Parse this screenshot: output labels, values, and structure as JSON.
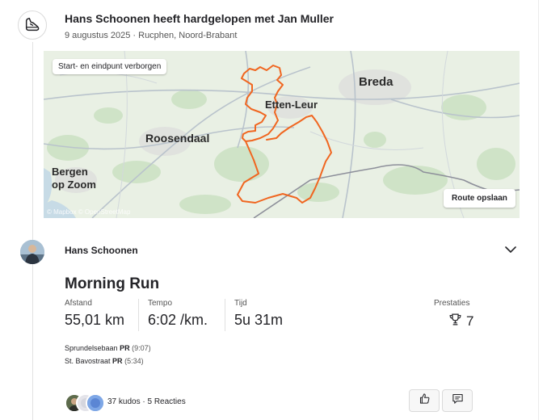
{
  "group": {
    "title": "Hans Schoonen heeft hardgelopen met Jan Muller",
    "subtitle": "9 augustus 2025 · Rucphen, Noord-Brabant",
    "icon": "running-shoe-icon"
  },
  "map": {
    "hidden_label": "Start- en eindpunt verborgen",
    "save_route_label": "Route opslaan",
    "attribution": "© Mapbox © OpenStreetMap",
    "places": {
      "breda": "Breda",
      "etten_leur": "Etten-Leur",
      "roosendaal": "Roosendaal",
      "bergen_line1": "Bergen",
      "bergen_line2": "op Zoom"
    },
    "route_color": "#f06620"
  },
  "athlete": {
    "name": "Hans Schoonen"
  },
  "activity": {
    "title": "Morning Run",
    "stats": [
      {
        "label": "Afstand",
        "value": "55,01 km"
      },
      {
        "label": "Tempo",
        "value": "6:02 /km."
      },
      {
        "label": "Tijd",
        "value": "5u 31m"
      }
    ],
    "achievements": {
      "label": "Prestaties",
      "count": "7",
      "icon": "trophy-icon"
    },
    "segments": [
      {
        "name": "Sprundelsebaan",
        "badge": "PR",
        "time": "(9:07)"
      },
      {
        "name": "St. Bavostraat",
        "badge": "PR",
        "time": "(5:34)"
      }
    ]
  },
  "social": {
    "kudos_text": "37 kudos · 5 Reacties",
    "kudo_icon": "thumbs-up-icon",
    "comment_icon": "comment-icon"
  }
}
